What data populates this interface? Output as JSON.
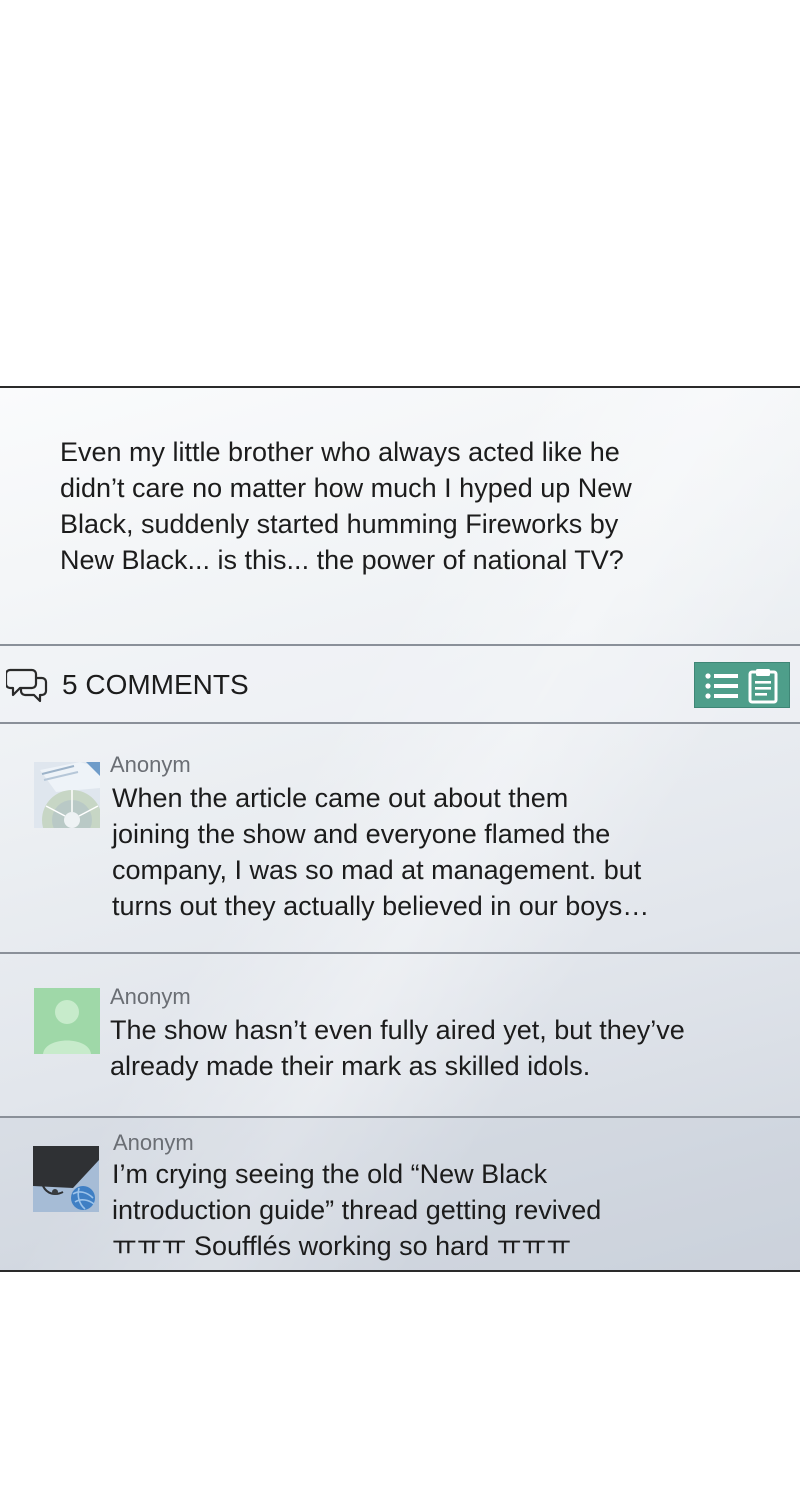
{
  "post": {
    "text": "Even my little brother who always acted like he\ndidn’t care no matter how much I hyped up New\nBlack, suddenly started humming Fireworks by\nNew Black... is this... the power of national TV?"
  },
  "comments_bar": {
    "icon": "speech-bubbles-icon",
    "count_label": "5 COMMENTS",
    "list_button_icon": "list-clipboard-icon",
    "accent_color": "#4e9e8a"
  },
  "comments": [
    {
      "author": "Anonym",
      "avatar": "document-chart-avatar",
      "text": "When the article came out about them\njoining the show and everyone flamed the\ncompany, I was so mad at management. but\nturns out they actually believed in our boys…"
    },
    {
      "author": "Anonym",
      "avatar": "default-person-avatar",
      "text": "The show hasn’t even fully aired yet, but they’ve\nalready made their mark as skilled idols."
    },
    {
      "author": "Anonym",
      "avatar": "yarn-ball-avatar",
      "text": "I’m crying seeing the old “New Black\nintroduction guide” thread getting revived\nㅠㅠㅠ Soufflés working so hard ㅠㅠㅠ"
    }
  ]
}
